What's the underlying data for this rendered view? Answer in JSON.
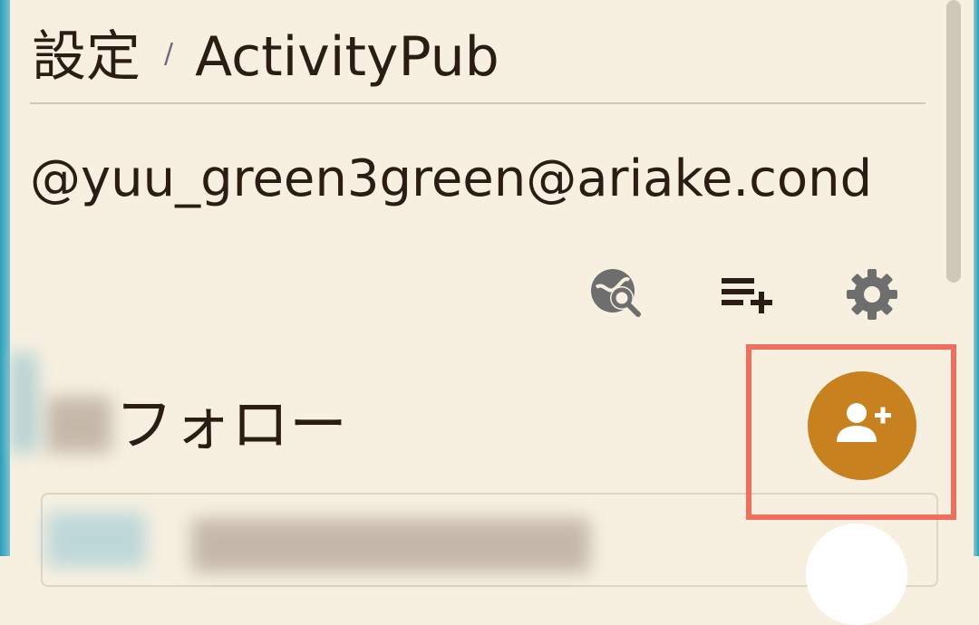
{
  "breadcrumb": {
    "root_label": "設定",
    "separator": "/",
    "current_label": "ActivityPub"
  },
  "account": {
    "handle": "@yuu_green3green@ariake.cond"
  },
  "toolbar": {
    "items": [
      {
        "name": "globe-search-icon"
      },
      {
        "name": "playlist-add-icon"
      },
      {
        "name": "gear-icon"
      }
    ]
  },
  "section": {
    "title": "フォロー"
  },
  "fab": {
    "icon": "person-add-icon",
    "color": "#c8811f"
  },
  "colors": {
    "background": "#f7f0e1",
    "text": "#2b1d14",
    "icon_gray": "#6e6e6e",
    "highlight": "#f06e5d",
    "edge": "#2b9fb8"
  }
}
